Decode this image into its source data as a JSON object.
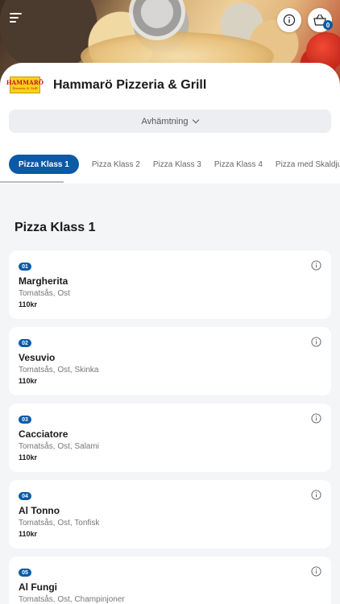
{
  "header": {
    "cart_count": "0"
  },
  "shop": {
    "logo_line1": "HAMMARÖ",
    "logo_line2": "Pizzeria & Grill",
    "name": "Hammarö Pizzeria & Grill"
  },
  "pickup": {
    "label": "Avhämtning"
  },
  "tabs": [
    {
      "label": "Pizza Klass 1",
      "active": true
    },
    {
      "label": "Pizza Klass 2"
    },
    {
      "label": "Pizza Klass 3"
    },
    {
      "label": "Pizza Klass 4"
    },
    {
      "label": "Pizza med Skaldjur"
    }
  ],
  "section": {
    "title": "Pizza Klass 1"
  },
  "items": [
    {
      "number": "01",
      "name": "Margherita",
      "desc": "Tomatsås, Ost",
      "price": "110kr"
    },
    {
      "number": "02",
      "name": "Vesuvio",
      "desc": "Tomatsås, Ost, Skinka",
      "price": "110kr"
    },
    {
      "number": "03",
      "name": "Cacciatore",
      "desc": "Tomatsås, Ost, Salami",
      "price": "110kr"
    },
    {
      "number": "04",
      "name": "Al Tonno",
      "desc": "Tomatsås, Ost, Tonfisk",
      "price": "110kr"
    },
    {
      "number": "05",
      "name": "Al Fungi",
      "desc": "Tomatsås, Ost, Champinjoner",
      "price": ""
    }
  ],
  "colors": {
    "accent": "#0c5aa6",
    "background": "#f4f5f7"
  },
  "icons": [
    "menu-icon",
    "info-icon",
    "cart-icon",
    "chevron-down-icon"
  ]
}
